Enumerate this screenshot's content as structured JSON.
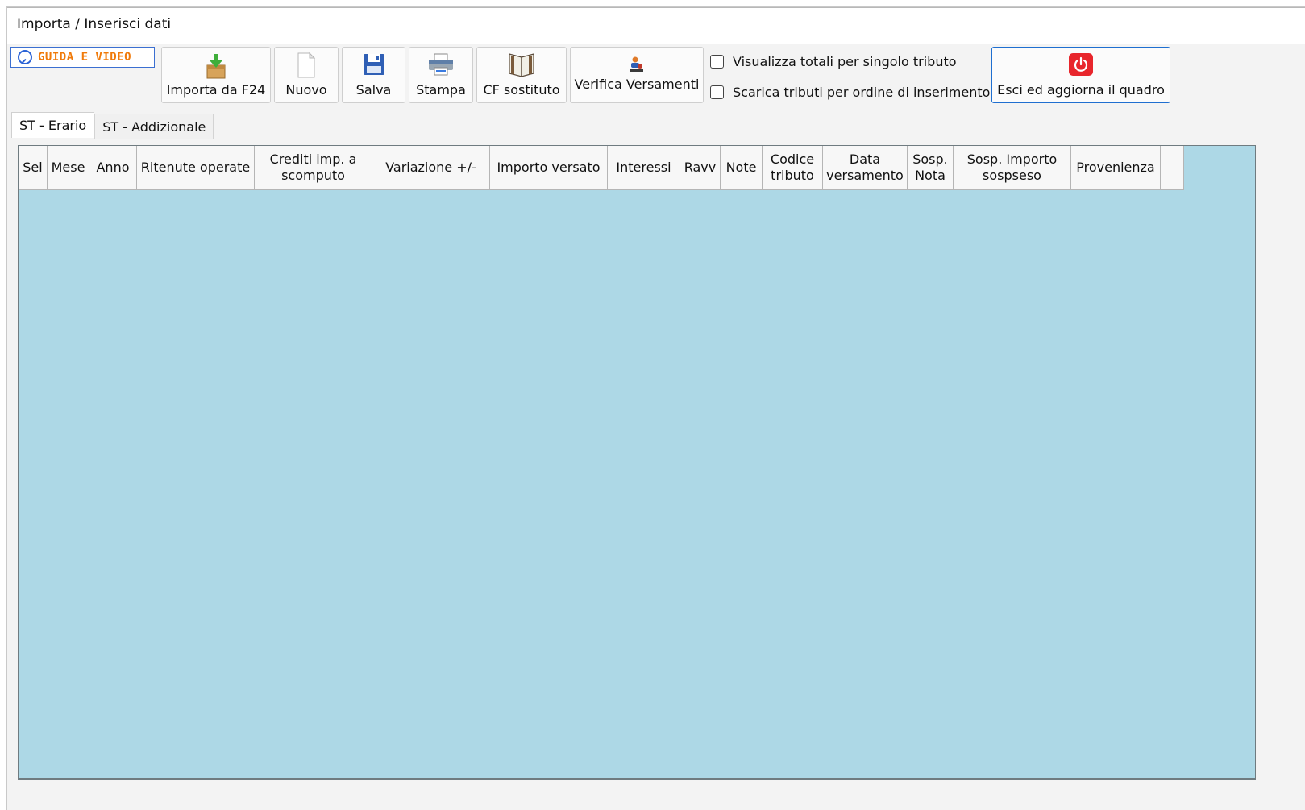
{
  "window": {
    "title": "Importa / Inserisci dati"
  },
  "guide": {
    "label": "GUIDA E VIDEO",
    "icon": "help-magnifier-icon"
  },
  "toolbar": {
    "import_label": "Importa da F24",
    "new_label": "Nuovo",
    "save_label": "Salva",
    "print_label": "Stampa",
    "cf_label": "CF sostituto",
    "verify_label": "Verifica Versamenti"
  },
  "options": {
    "show_totals": {
      "label": "Visualizza totali per singolo tributo",
      "checked": false
    },
    "download_order": {
      "label": "Scarica tributi per ordine di inserimento",
      "checked": false
    }
  },
  "exit": {
    "label": "Esci ed aggiorna il quadro"
  },
  "tabs": [
    {
      "label": "ST - Erario",
      "active": true
    },
    {
      "label": "ST - Addizionale",
      "active": false
    }
  ],
  "table": {
    "columns": [
      "Sel",
      "Mese",
      "Anno",
      "Ritenute operate",
      "Crediti imp. a scomputo",
      "Variazione +/-",
      "Importo versato",
      "Interessi",
      "Ravv",
      "Note",
      "Codice tributo",
      "Data versamento",
      "Sosp. Nota",
      "Sosp. Importo sospseso",
      "Provenienza",
      ""
    ],
    "rows": []
  },
  "colors": {
    "grid_background": "#add8e6",
    "exit_accent": "#1f6fd0",
    "power_icon": "#e8262c",
    "guide_text": "#f07a0a"
  }
}
